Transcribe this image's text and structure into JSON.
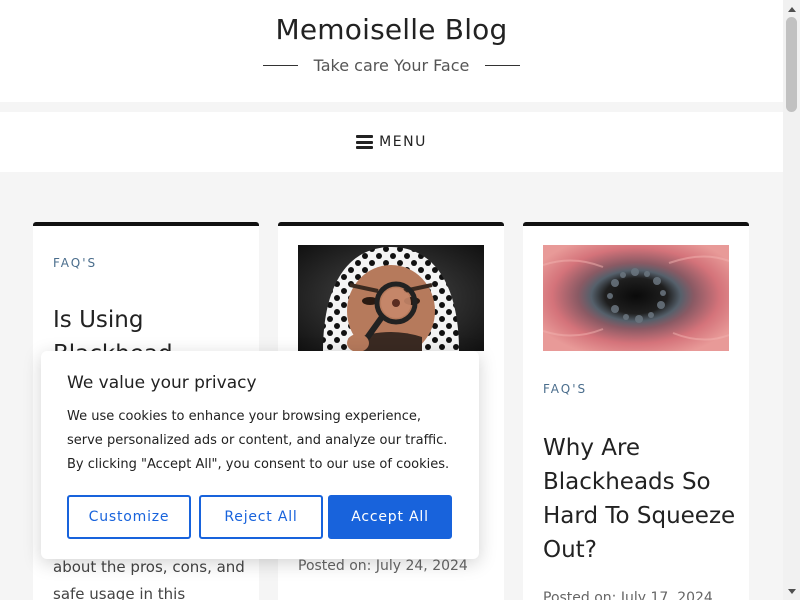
{
  "header": {
    "site_title": "Memoiselle Blog",
    "tagline": "Take care Your Face"
  },
  "nav": {
    "menu_label": "MENU"
  },
  "cards": [
    {
      "category": "FAQ'S",
      "title_lines": [
        "Is Using",
        "Blackhead"
      ],
      "excerpt_lines": [
        "about the pros, cons, and",
        "safe usage in this"
      ]
    },
    {
      "date": "Posted on: July 24, 2024"
    },
    {
      "category": "FAQ'S",
      "title_lines": [
        "Why Are",
        "Blackheads So",
        "Hard To Squeeze",
        "Out?"
      ],
      "date": "Posted on: July 17, 2024"
    }
  ],
  "cookie_banner": {
    "title": "We value your privacy",
    "text": "We use cookies to enhance your browsing experience, serve personalized ads or content, and analyze our traffic. By clicking \"Accept All\", you consent to our use of cookies.",
    "customize_label": "Customize",
    "reject_label": "Reject All",
    "accept_label": "Accept All"
  },
  "colors": {
    "accent": "#1863dc",
    "category": "#4a6d8c",
    "card_border": "#111111"
  }
}
